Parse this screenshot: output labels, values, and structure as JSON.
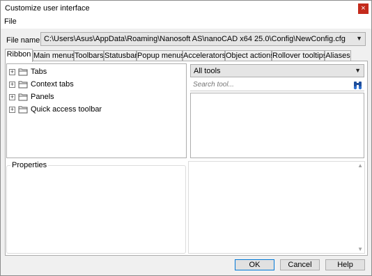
{
  "window": {
    "title": "Customize user interface",
    "close_glyph": "×"
  },
  "menubar": {
    "items": [
      "File"
    ]
  },
  "file_name": {
    "label": "File name:",
    "value": "C:\\Users\\Asus\\AppData\\Roaming\\Nanosoft AS\\nanoCAD x64 25.0\\Config\\NewConfig.cfg"
  },
  "tabs": [
    "Ribbon",
    "Main menus",
    "Toolbars",
    "Statusbar",
    "Popup menus",
    "Accelerators",
    "Object actions",
    "Rollover tooltips",
    "Aliases"
  ],
  "active_tab": "Ribbon",
  "tree": {
    "expander_glyph": "+",
    "items": [
      {
        "label": "Tabs",
        "icon": "folder-icon"
      },
      {
        "label": "Context tabs",
        "icon": "folder-icon"
      },
      {
        "label": "Panels",
        "icon": "folder-icon"
      },
      {
        "label": "Quick access toolbar",
        "icon": "folder-icon"
      }
    ]
  },
  "tools": {
    "filter_value": "All tools",
    "search_placeholder": "Search tool..."
  },
  "properties": {
    "label": "Properties"
  },
  "buttons": {
    "ok": "OK",
    "cancel": "Cancel",
    "help": "Help"
  },
  "colors": {
    "accent": "#0078d7",
    "close": "#c42b1c",
    "folder": "#e8c45a"
  }
}
